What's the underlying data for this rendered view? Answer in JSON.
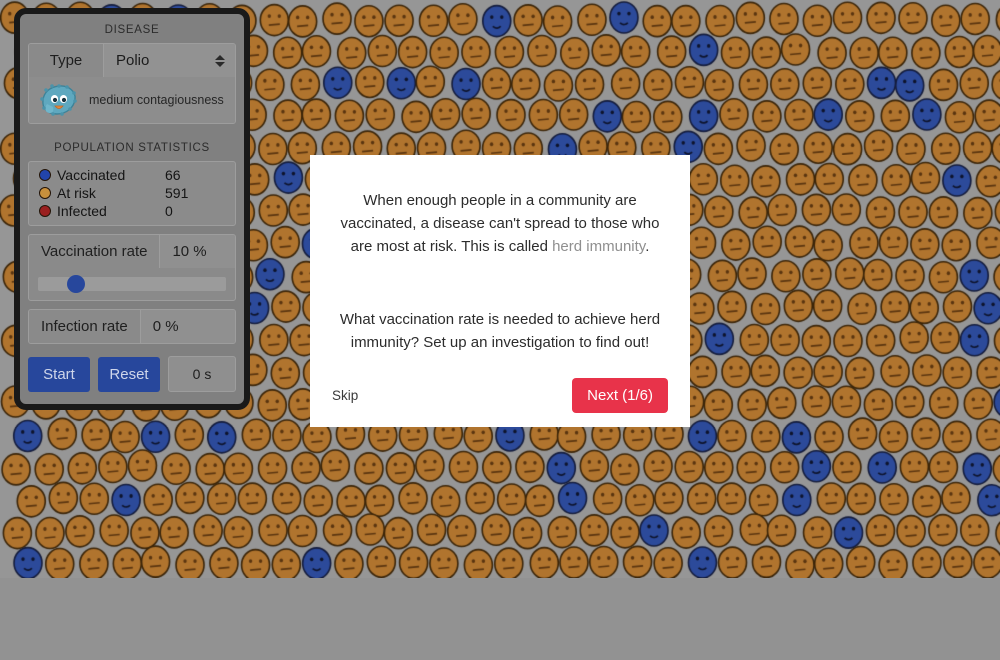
{
  "background_color": "#969696",
  "panel": {
    "disease_section": {
      "title": "DISEASE",
      "type_label": "Type",
      "type_value": "Polio",
      "type_options": [
        "Polio"
      ],
      "germ_icon": "germ-icon",
      "contagiousness_caption": "medium contagiousness"
    },
    "population_section": {
      "title": "POPULATION STATISTICS",
      "stats": [
        {
          "label": "Vaccinated",
          "value": "66",
          "color": "#2244aa"
        },
        {
          "label": "At risk",
          "value": "591",
          "color": "#c8903c"
        },
        {
          "label": "Infected",
          "value": "0",
          "color": "#9a1f1f"
        }
      ],
      "vaccination_rate_label": "Vaccination rate",
      "vaccination_rate_value": "10 %",
      "vaccination_rate_percent": 10,
      "infection_rate_label": "Infection rate",
      "infection_rate_value": "0 %",
      "start_label": "Start",
      "reset_label": "Reset",
      "timer_value": "0 s"
    }
  },
  "modal": {
    "paragraph1_part1": "When enough people in a community are vaccinated, a disease can't spread to those who are most at risk. This is called ",
    "paragraph1_term": "herd immunity",
    "paragraph1_part2": ".",
    "paragraph2": "What vaccination rate is needed to achieve herd immunity? Set up an investigation to find out!",
    "skip_label": "Skip",
    "next_label": "Next (1/6)",
    "next_color": "#e8334a"
  },
  "population_grid": {
    "vaccinated_count": 66,
    "at_risk_count": 591,
    "infected_count": 0,
    "vaccinated_color": "#2c4a9a",
    "at_risk_color": "#b0742e",
    "outline_color": "#3a2408",
    "vaccinated_outline_color": "#141c3c",
    "face_width": 28,
    "face_height": 31,
    "column_pitch": 32,
    "row_pitch": 32,
    "rows": 18,
    "columns": 32
  }
}
